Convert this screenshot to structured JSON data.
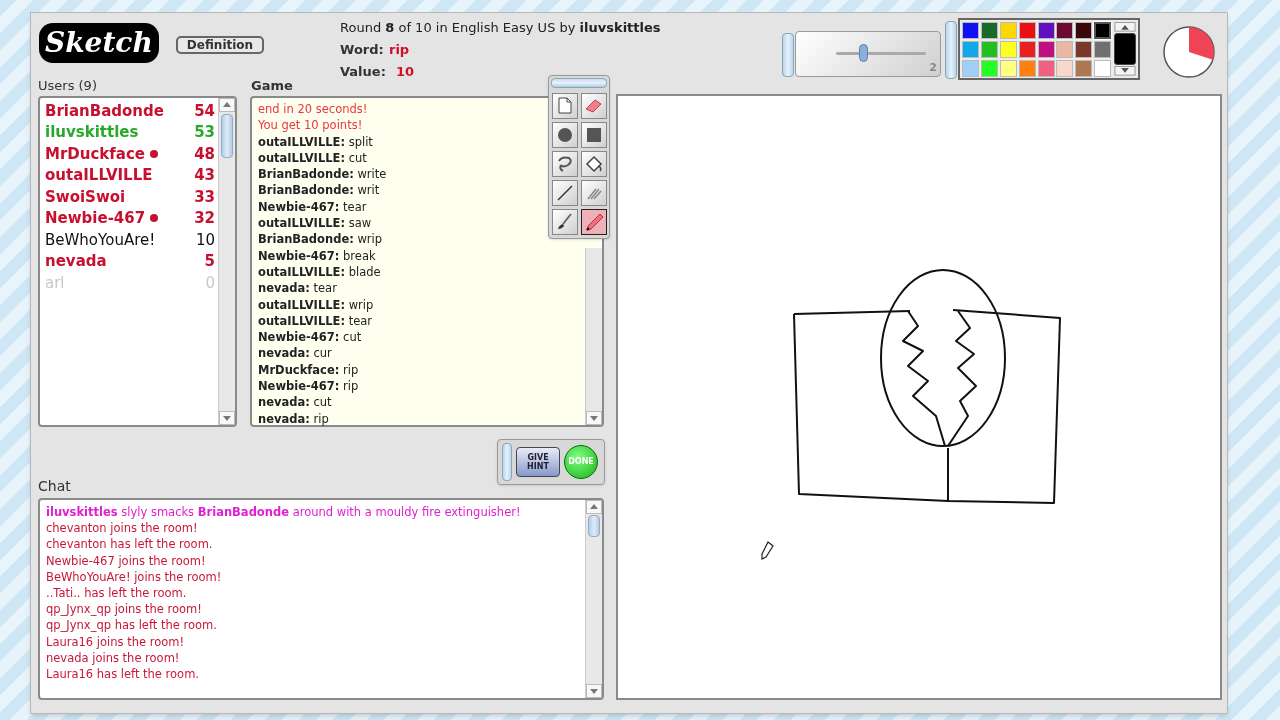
{
  "header": {
    "logo": "Sketch",
    "definition_button": "Definition",
    "round_info": "Round **8** of 10 in English Easy US by **iluvskittles**",
    "word_label": "Word:",
    "word": "rip",
    "value_label": "Value:",
    "value": "10"
  },
  "brush": {
    "level": 0.3,
    "reading": "2"
  },
  "palette": {
    "swatches": [
      {
        "color": "#1010f0",
        "selected": false
      },
      {
        "color": "#1a6b2a",
        "selected": false
      },
      {
        "color": "#ffd700",
        "selected": false
      },
      {
        "color": "#e81010",
        "selected": false
      },
      {
        "color": "#6010c0",
        "selected": false
      },
      {
        "color": "#6a0a30",
        "selected": false
      },
      {
        "color": "#3a0808",
        "selected": false
      },
      {
        "color": "#000000",
        "selected": true
      },
      {
        "color": "#10a8e8",
        "selected": false
      },
      {
        "color": "#20c020",
        "selected": false
      },
      {
        "color": "#ffff20",
        "selected": false
      },
      {
        "color": "#e82020",
        "selected": false
      },
      {
        "color": "#c01080",
        "selected": false
      },
      {
        "color": "#e8b8a0",
        "selected": false
      },
      {
        "color": "#7a3828",
        "selected": false
      },
      {
        "color": "#707070",
        "selected": false
      },
      {
        "color": "#a0d0f8",
        "selected": false
      },
      {
        "color": "#20ff20",
        "selected": false
      },
      {
        "color": "#ffff80",
        "selected": false
      },
      {
        "color": "#ff8010",
        "selected": false
      },
      {
        "color": "#f06080",
        "selected": false
      },
      {
        "color": "#f8d8c8",
        "selected": false
      },
      {
        "color": "#b07850",
        "selected": false
      },
      {
        "color": "#ffffff",
        "selected": false
      }
    ]
  },
  "users": {
    "title": "Users (9)",
    "items": [
      {
        "name": "BrianBadonde",
        "score": "54",
        "color": "#c8102e",
        "bold": true,
        "dot": false
      },
      {
        "name": "iluvskittles",
        "score": "53",
        "color": "#2aa82a",
        "bold": true,
        "dot": false
      },
      {
        "name": "MrDuckface",
        "score": "48",
        "color": "#c8102e",
        "bold": true,
        "dot": true
      },
      {
        "name": "outaILLVILLE",
        "score": "43",
        "color": "#c8102e",
        "bold": true,
        "dot": false
      },
      {
        "name": "SwoiSwoi",
        "score": "33",
        "color": "#c8102e",
        "bold": true,
        "dot": false
      },
      {
        "name": "Newbie-467",
        "score": "32",
        "color": "#c8102e",
        "bold": true,
        "dot": true
      },
      {
        "name": "BeWhoYouAre!",
        "score": "10",
        "color": "#111111",
        "bold": false,
        "dot": false
      },
      {
        "name": "nevada",
        "score": "5",
        "color": "#c8102e",
        "bold": true,
        "dot": false
      },
      {
        "name": "arl",
        "score": "0",
        "color": "#c8c8c8",
        "bold": false,
        "dot": false
      }
    ]
  },
  "game": {
    "title": "Game",
    "messages": [
      {
        "kind": "system",
        "text": "end in 20 seconds!"
      },
      {
        "kind": "system",
        "text": "You get 10 points!"
      },
      {
        "kind": "guess",
        "user": "outaILLVILLE:",
        "text": "split"
      },
      {
        "kind": "guess",
        "user": "outaILLVILLE:",
        "text": "cut"
      },
      {
        "kind": "guess",
        "user": "BrianBadonde:",
        "text": "write"
      },
      {
        "kind": "guess",
        "user": "BrianBadonde:",
        "text": "writ"
      },
      {
        "kind": "guess",
        "user": "Newbie-467:",
        "text": "tear"
      },
      {
        "kind": "guess",
        "user": "outaILLVILLE:",
        "text": "saw"
      },
      {
        "kind": "guess",
        "user": "BrianBadonde:",
        "text": "wrip"
      },
      {
        "kind": "guess",
        "user": "Newbie-467:",
        "text": "break"
      },
      {
        "kind": "guess",
        "user": "outaILLVILLE:",
        "text": "blade"
      },
      {
        "kind": "guess",
        "user": "nevada:",
        "text": "tear"
      },
      {
        "kind": "guess",
        "user": "outaILLVILLE:",
        "text": "wrip"
      },
      {
        "kind": "guess",
        "user": "outaILLVILLE:",
        "text": "tear"
      },
      {
        "kind": "guess",
        "user": "Newbie-467:",
        "text": "cut"
      },
      {
        "kind": "guess",
        "user": "nevada:",
        "text": "cur"
      },
      {
        "kind": "guess",
        "user": "MrDuckface:",
        "text": "rip"
      },
      {
        "kind": "guess",
        "user": "Newbie-467:",
        "text": "rip"
      },
      {
        "kind": "guess",
        "user": "nevada:",
        "text": "cut"
      },
      {
        "kind": "guess",
        "user": "nevada:",
        "text": "rip"
      }
    ]
  },
  "tools": [
    {
      "kind": "new",
      "selected": false
    },
    {
      "kind": "eraser",
      "selected": false
    },
    {
      "kind": "circle",
      "selected": false
    },
    {
      "kind": "square",
      "selected": false
    },
    {
      "kind": "lasso",
      "selected": false
    },
    {
      "kind": "fill",
      "selected": false
    },
    {
      "kind": "line",
      "selected": false
    },
    {
      "kind": "smudge",
      "selected": false
    },
    {
      "kind": "brush",
      "selected": false
    },
    {
      "kind": "pencil",
      "selected": true
    }
  ],
  "actions": {
    "hint": "GIVE HINT",
    "done": "DONE"
  },
  "chat": {
    "title": "Chat",
    "messages": [
      {
        "kind": "action",
        "text": "**iluvskittles** slyly smacks **BrianBadonde** around with a mouldy fire extinguisher!"
      },
      {
        "kind": "notice",
        "text": "chevanton joins the room!"
      },
      {
        "kind": "notice",
        "text": "chevanton has left the room."
      },
      {
        "kind": "notice",
        "text": "Newbie-467 joins the room!"
      },
      {
        "kind": "notice",
        "text": "BeWhoYouAre! joins the room!"
      },
      {
        "kind": "notice",
        "text": "..Tati.. has left the room."
      },
      {
        "kind": "notice",
        "text": "qp_Jynx_qp joins the room!"
      },
      {
        "kind": "notice",
        "text": "qp_Jynx_qp has left the room."
      },
      {
        "kind": "notice",
        "text": "Laura16 joins the room!"
      },
      {
        "kind": "notice",
        "text": "nevada joins the room!"
      },
      {
        "kind": "notice",
        "text": "Laura16 has left the room."
      }
    ]
  }
}
